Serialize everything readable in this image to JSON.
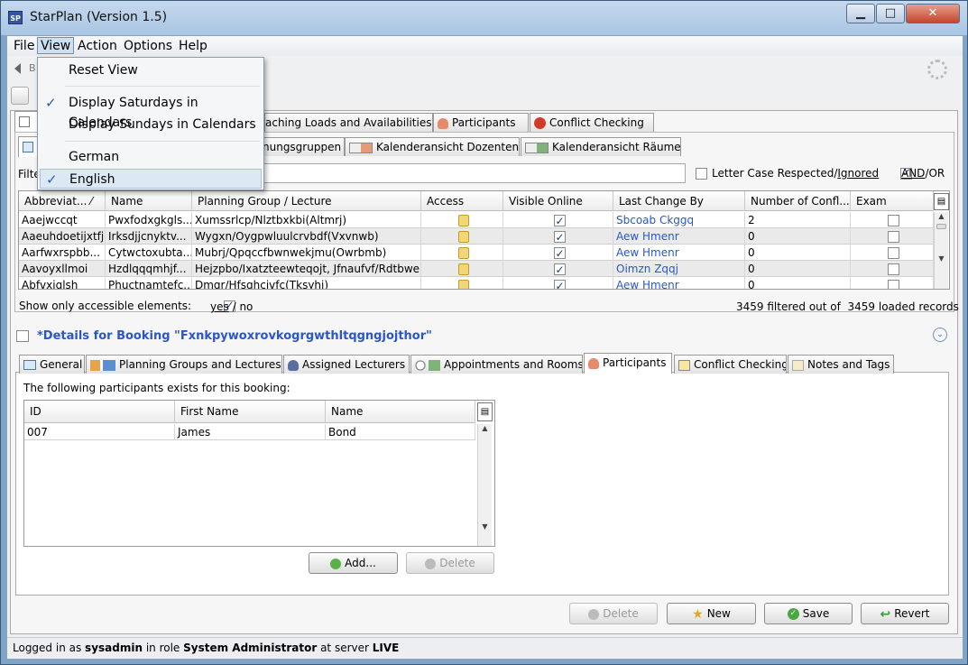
{
  "window": {
    "icon_text": "SP",
    "title": "StarPlan (Version 1.5)",
    "minimize": "▁",
    "maximize": "□",
    "close": "✕"
  },
  "menubar": [
    "File",
    "View",
    "Action",
    "Options",
    "Help"
  ],
  "view_menu": {
    "reset": "Reset View",
    "saturdays": "Display Saturdays in Calendars",
    "sundays": "Display Sundays in Calendars",
    "german": "German",
    "english": "English",
    "saturdays_checked": true,
    "english_checked": true
  },
  "toolbar": {
    "back_text": "B"
  },
  "main_tabs": [
    {
      "label": "",
      "icon": "edit-icon"
    },
    {
      "label": "aching Loads and Availabilities",
      "icon": ""
    },
    {
      "label": "Participants",
      "icon": "person-icon"
    },
    {
      "label": "Conflict Checking",
      "icon": "warning-icon"
    }
  ],
  "sub_tabs": [
    {
      "label": "",
      "icon": "table-icon"
    },
    {
      "label": "nungsgruppen",
      "icon": ""
    },
    {
      "label": "Kalenderansicht Dozenten",
      "icon": "calendar-person-icon"
    },
    {
      "label": "Kalenderansicht Räume",
      "icon": "calendar-room-icon"
    }
  ],
  "filter": {
    "label": "Filte",
    "value": "",
    "letter_case_label": "Letter Case Respected/",
    "letter_case_ignored": "Ignored",
    "letter_case_checked": false,
    "andor_label_and": "AND",
    "andor_label_or": "/OR",
    "andor_checked": true
  },
  "table": {
    "columns": [
      "Abbreviat... ⁄",
      "Name",
      "Planning Group / Lecture",
      "Access",
      "Visible Online",
      "Last Change By",
      "Number of Confl...",
      "Exam"
    ],
    "rows": [
      {
        "abbr": "Aaejwccqt",
        "name": "Pwxfodxgkgls...",
        "group": "Xumssrlcp/Nlztbxkbi(Altmrj)",
        "visible": true,
        "changed_by": "Sbcoab Ckggq",
        "conflicts": "2",
        "exam": false
      },
      {
        "abbr": "Aaeuhdoetijxtfj",
        "name": "Irksdjjcnyktv...",
        "group": "Wygxn/Oygpwluulcrvbdf(Vxvnwb)",
        "visible": true,
        "changed_by": "Aew Hmenr",
        "conflicts": "0",
        "exam": false
      },
      {
        "abbr": "Aarfwxrspbb...",
        "name": "Cytwctoxubta...",
        "group": "Mubrj/Qpqccfbwnwekjmu(Owrbmb)",
        "visible": true,
        "changed_by": "Aew Hmenr",
        "conflicts": "0",
        "exam": false
      },
      {
        "abbr": "Aavoyxllmoi",
        "name": "Hzdlqqqmhjf...",
        "group": "Hejzpbo/Ixatzteewteqojt, Jfnaufvf/Rdtbwe...",
        "visible": true,
        "changed_by": "Oimzn Zqqj",
        "conflicts": "0",
        "exam": false
      },
      {
        "abbr": "Abfvxiqlsh",
        "name": "Phuctnamtefc...",
        "group": "Dmgr/Hfsghcivfc(Tksyhj)",
        "visible": true,
        "changed_by": "Aew Hmenr",
        "conflicts": "0",
        "exam": false
      }
    ]
  },
  "accessible": {
    "label": "Show only accessible elements:",
    "yes": "yes",
    "separator": "/",
    "no": "no",
    "checked": true
  },
  "records": {
    "text": "3459 filtered out of",
    "loaded": "3459 loaded records"
  },
  "details": {
    "title": "*Details for Booking \"Fxnkpywoxrovkogrgwthltqgngjojthor\"",
    "tabs": [
      {
        "label": "General",
        "icon": "form-icon"
      },
      {
        "label": "Planning Groups and Lectures",
        "icon": "group-icon"
      },
      {
        "label": "Assigned Lecturers",
        "icon": "lecturer-icon"
      },
      {
        "label": "Appointments and Rooms",
        "icon": "clock-icon"
      },
      {
        "label": "Participants",
        "icon": "person-icon"
      },
      {
        "label": "Conflict Checking",
        "icon": "calendar-icon"
      },
      {
        "label": "Notes and Tags",
        "icon": "note-icon"
      }
    ],
    "active_tab": "Participants",
    "participants_intro": "The following participants exists for this booking:",
    "participants_columns": [
      "ID",
      "First Name",
      "Name"
    ],
    "participants_rows": [
      {
        "id": "007",
        "first": "James",
        "last": "Bond"
      }
    ],
    "add_label": "Add...",
    "delete_label": "Delete"
  },
  "actions": {
    "delete": "Delete",
    "new": "New",
    "save": "Save",
    "revert": "Revert"
  },
  "status": {
    "prefix": "Logged in as ",
    "user": "sysadmin",
    "mid": " in role ",
    "role": "System Administrator",
    "mid2": " at server ",
    "server": "LIVE"
  }
}
